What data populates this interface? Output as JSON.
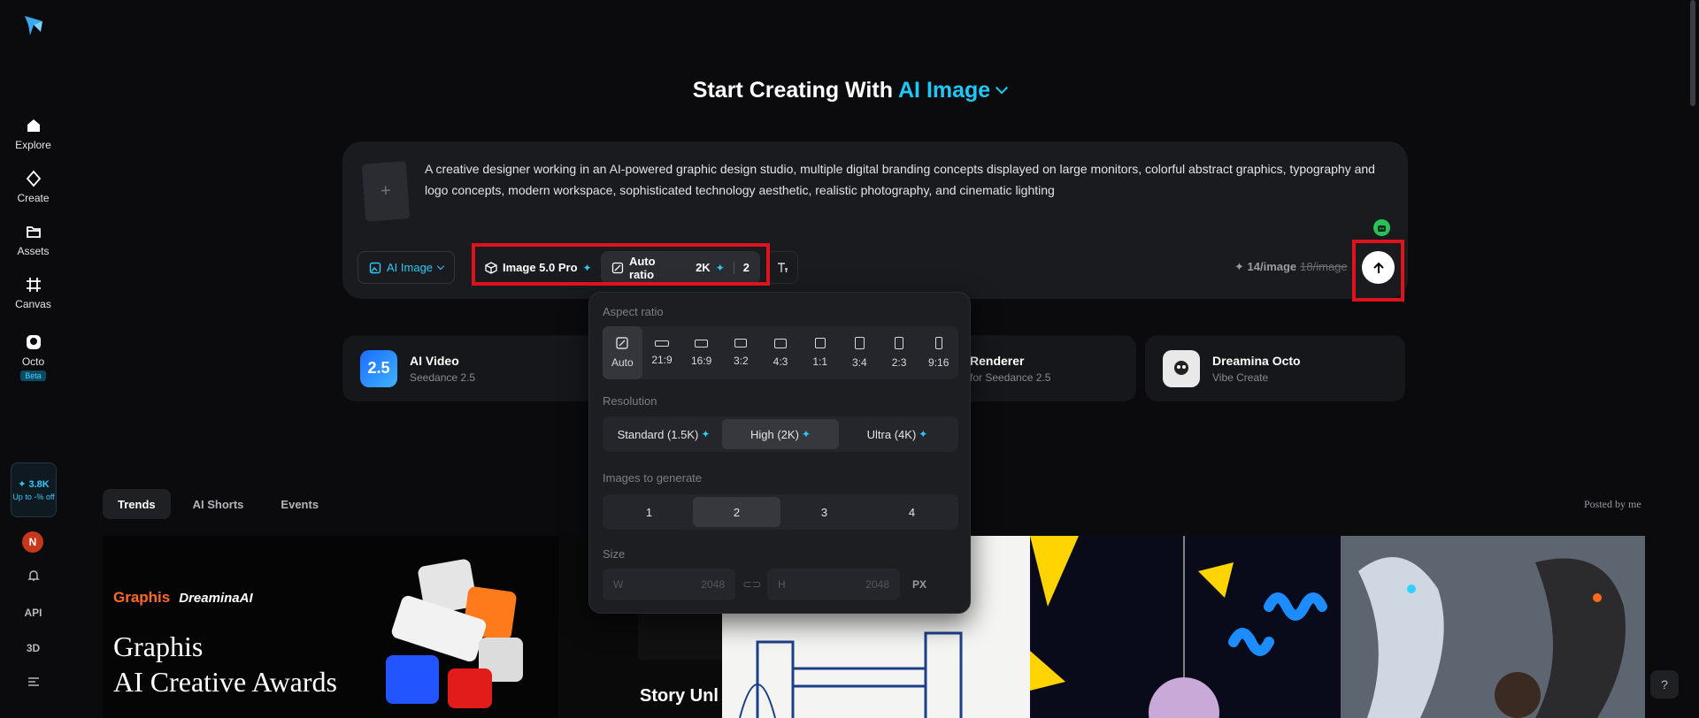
{
  "sidebar": {
    "nav": [
      {
        "label": "Explore",
        "icon": "home-icon"
      },
      {
        "label": "Create",
        "icon": "diamond-icon"
      },
      {
        "label": "Assets",
        "icon": "folder-icon"
      },
      {
        "label": "Canvas",
        "icon": "canvas-icon"
      },
      {
        "label": "Octo",
        "icon": "octo-icon"
      }
    ],
    "beta_badge": "Beta",
    "credits": "✦ 3.8K",
    "promo": "Up to -% off",
    "avatar_initial": "N",
    "api_label": "API",
    "threed_label": "3D"
  },
  "header": {
    "title_prefix": "Start Creating With",
    "title_accent": "AI Image"
  },
  "prompt": {
    "upload_plus": "+",
    "text": "A creative designer working in an AI-powered graphic design studio, multiple digital branding concepts displayed on large monitors, colorful abstract graphics, typography and logo concepts, modern workspace, sophisticated technology aesthetic, realistic photography, and cinematic lighting",
    "mode_label": "AI Image",
    "model_label": "Image 5.0 Pro",
    "ratio_label": "Auto ratio",
    "resolution_label": "2K",
    "count_label": "2",
    "cost_label": "✦ 14/image",
    "cost_old": "18/image"
  },
  "cards": [
    {
      "title": "AI Video",
      "sub": "Seedance 2.5",
      "icon_text": "2.5"
    },
    {
      "title": "Renderer",
      "sub": "for Seedance 2.5"
    },
    {
      "title": "Dreamina Octo",
      "sub": "Vibe Create"
    }
  ],
  "popover": {
    "aspect_label": "Aspect ratio",
    "ratios": [
      "Auto",
      "21:9",
      "16:9",
      "3:2",
      "4:3",
      "1:1",
      "3:4",
      "2:3",
      "9:16"
    ],
    "active_ratio": "Auto",
    "resolution_label": "Resolution",
    "resolutions": [
      "Standard (1.5K)",
      "High (2K)",
      "Ultra (4K)"
    ],
    "active_resolution": "High (2K)",
    "images_label": "Images to generate",
    "counts": [
      "1",
      "2",
      "3",
      "4"
    ],
    "active_count": "2",
    "size_label": "Size",
    "width_prefix": "W",
    "width_value": "2048",
    "height_prefix": "H",
    "height_value": "2048",
    "unit": "PX"
  },
  "tabs": [
    "Trends",
    "AI Shorts",
    "Events"
  ],
  "posted_by": "Posted by me",
  "gallery": {
    "brand_left": "Graphis",
    "brand_right": "DreaminaAI",
    "big_line1": "Graphis",
    "big_line2": "AI Creative Awards",
    "story": "Story Unl"
  },
  "colors": {
    "accent": "#1fc8f7",
    "highlight": "#e0121b"
  }
}
